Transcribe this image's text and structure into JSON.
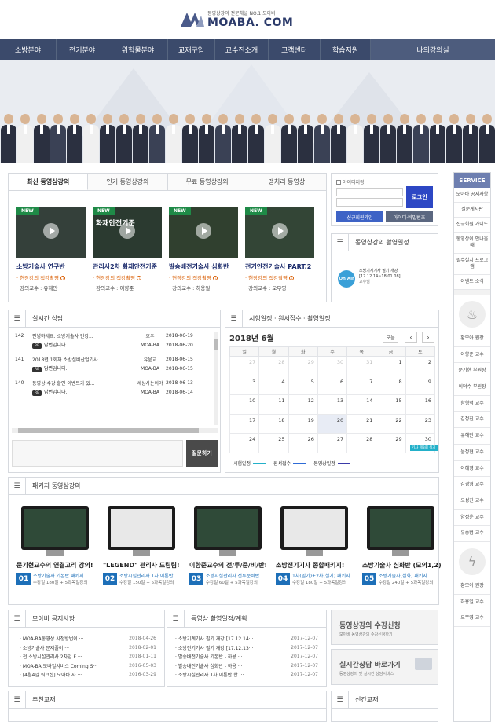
{
  "header": {
    "tagline": "동영상강의 전문채널 NO.1 모아바",
    "logo": "MOABA. COM"
  },
  "nav": [
    "소방분야",
    "전기분야",
    "위험물분야",
    "교재구입",
    "교수진소개",
    "고객센터",
    "학습지원",
    "나의강의실"
  ],
  "latest": {
    "tabs": [
      "최신 동영상강의",
      "인기 동영상강의",
      "무료 동영상강의",
      "맹처리 동영상"
    ],
    "new_badge": "NEW",
    "videos": [
      {
        "title": "소방기술사 연구반",
        "tag": "· 현장강의 직강촬영",
        "prof": "· 강의교수 : 유해만",
        "overlay": ""
      },
      {
        "title": "관리사2차 화재안전기준",
        "tag": "· 현장강의 직강촬영",
        "prof": "· 강의교수 : 이향준",
        "overlay": "화재안전기준"
      },
      {
        "title": "발송배전기술사 심화반",
        "tag": "· 현장강의 직강촬영",
        "prof": "· 강의교수 : 하용일",
        "overlay": ""
      },
      {
        "title": "전기안전기술사 PART.2",
        "tag": "· 현장강의 직강촬영",
        "prof": "· 강의교수 : 오무영",
        "overlay": ""
      }
    ]
  },
  "login": {
    "save_id": "아이디저장",
    "button": "로그인",
    "join": "신규회원가입",
    "find": "아이디·비밀번호"
  },
  "schedule_box": {
    "title": "동영상강의 촬영일정",
    "badge": "On Air",
    "text1": "소방기계기사 필기 개강",
    "text2": "[17.12.14~18.01.08]",
    "text3": "교수님"
  },
  "consult": {
    "title": "실시간 상담",
    "rows": [
      {
        "no": "142",
        "q": "안녕하세요. 소방기술사 인강...",
        "who": "호우",
        "date": "2018-06-19",
        "reply": "답변입니다.",
        "rwho": "MOA-BA",
        "rdate": "2018-06-20"
      },
      {
        "no": "141",
        "q": "2018년 1회차 소방설비산업기사...",
        "who": "유윤교",
        "date": "2018-06-15",
        "reply": "답변입니다.",
        "rwho": "MOA-BA",
        "rdate": "2018-06-15"
      },
      {
        "no": "140",
        "q": "동영상 수강 할인 이벤트가 있...",
        "who": "세상사는이야",
        "date": "2018-06-13",
        "reply": "답변입니다.",
        "rwho": "MOA-BA",
        "rdate": "2018-06-14"
      }
    ],
    "ask_button": "질문하기"
  },
  "calendar": {
    "title": "시험일정 · 원서접수 · 촬영일정",
    "month": "2018년 6월",
    "today": "오늘",
    "days": [
      "일",
      "월",
      "화",
      "수",
      "목",
      "금",
      "토"
    ],
    "weeks": [
      [
        [
          "27",
          1
        ],
        [
          "28",
          1
        ],
        [
          "29",
          1
        ],
        [
          "30",
          1
        ],
        [
          "31",
          1
        ],
        [
          "1",
          0
        ],
        [
          "2",
          0
        ]
      ],
      [
        [
          "3",
          0
        ],
        [
          "4",
          0
        ],
        [
          "5",
          0
        ],
        [
          "6",
          0
        ],
        [
          "7",
          0
        ],
        [
          "8",
          0
        ],
        [
          "9",
          0
        ]
      ],
      [
        [
          "10",
          0
        ],
        [
          "11",
          0
        ],
        [
          "12",
          0
        ],
        [
          "13",
          0
        ],
        [
          "14",
          0
        ],
        [
          "15",
          0
        ],
        [
          "16",
          0
        ]
      ],
      [
        [
          "17",
          0
        ],
        [
          "18",
          0
        ],
        [
          "19",
          0
        ],
        [
          "20",
          0
        ],
        [
          "21",
          0
        ],
        [
          "22",
          0
        ],
        [
          "23",
          0
        ]
      ],
      [
        [
          "24",
          0
        ],
        [
          "25",
          0
        ],
        [
          "26",
          0
        ],
        [
          "27",
          0
        ],
        [
          "28",
          0
        ],
        [
          "29",
          0
        ],
        [
          "30",
          0
        ]
      ]
    ],
    "event": "기사 제3회 실기",
    "legend": [
      {
        "label": "시험일정",
        "color": "#23b0c9"
      },
      {
        "label": "원서접수",
        "color": "#2e6bd6"
      },
      {
        "label": "동영상일정",
        "color": "#3a3aa8"
      }
    ]
  },
  "packages": {
    "title": "패키지 동영상강의",
    "items": [
      {
        "num": "01",
        "title": "문기현교수의 연결고리 강의!",
        "name": "소방기술사 기본반 패키지",
        "desc": "수강일 180일 + 5과목일강의"
      },
      {
        "num": "02",
        "title": "\"LEGEND\" 관리사 드림팀!",
        "name": "소방시설관리사 1차 이론반",
        "desc": "수강일 150일 + 5과목일강의"
      },
      {
        "num": "03",
        "title": "이향준교수의 전/투/준/비/반!",
        "name": "소방시설관리사 전투준비반",
        "desc": "수강일 60일 + 5과목일강의"
      },
      {
        "num": "04",
        "title": "소방전기기사 종합패키지!",
        "name": "1차(필기)+2차(실기) 패키지",
        "desc": "수강일 180일 + 5과목일강의"
      },
      {
        "num": "05",
        "title": "소방기술사 심화반 (모의1,2)",
        "name": "소방기술사(심화) 패키지",
        "desc": "수강일 240일 + 5과목일강의"
      }
    ]
  },
  "notice": {
    "title": "모아바 공지사항",
    "rows": [
      {
        "t": "· MOA-BA동영상 시청방법이 ···",
        "d": "2018-04-26"
      },
      {
        "t": "· 소방기술사 문제풀이 ···",
        "d": "2018-02-01"
      },
      {
        "t": "· 전 소방시설관리사 2차임 F ···",
        "d": "2018-01-11"
      },
      {
        "t": "· MOA-BA 모바일서비스 Coming S···",
        "d": "2016-05-03"
      },
      {
        "t": "· [4월4일 워크샵] 모아바 사 ···",
        "d": "2016-03-29"
      }
    ]
  },
  "shoot": {
    "title": "동영상 촬영일정/계획",
    "rows": [
      {
        "t": "· 소방기계기사 필기 개강 [17.12.14···",
        "d": "2017-12-07"
      },
      {
        "t": "· 소방전기기사 필기 개강 [17.12.13···",
        "d": "2017-12-07"
      },
      {
        "t": "· 발송배전기술사 기본반 - 하용 ···",
        "d": "2017-12-07"
      },
      {
        "t": "· 발송배전기술사 심화반 - 하용 ···",
        "d": "2017-12-07"
      },
      {
        "t": "· 소방시설관리사 1차 이론반 합 ···",
        "d": "2017-12-07"
      }
    ]
  },
  "banners": {
    "b1_title": "동영상강의 수강신청",
    "b1_sub": "모아바 동영상강의 수강신청하기",
    "b2_title": "실시간상담 바로가기",
    "b2_sub": "동영상강의 및 실시간 상담서비스"
  },
  "bottom": {
    "textbook": "추천교재",
    "newbook": "신간교재"
  },
  "sidebar": {
    "header": "SERVICE",
    "items": [
      "모아바 공지사항",
      "질문게시판",
      "신규회원 가이드",
      "동영상이 안나올때",
      "필수설치 프로그램",
      "이벤트 소식"
    ],
    "profs1": [
      "황모아 원장",
      "이향준 교수",
      "문기현 부원장",
      "이덕수 부원장",
      "함형덕 교수",
      "김정진 교수",
      "유해만 교수",
      "윤정현 교수",
      "이혜영 교수",
      "김경영 교수",
      "오성진 교수",
      "양성운 교수",
      "유승범 교수"
    ],
    "profs2": [
      "황모아 원장",
      "하용일 교수",
      "오무영 교수"
    ]
  },
  "colors": {
    "nav": "#3b4a6b",
    "accent": "#2d47c4",
    "number": "#1d6fb8"
  }
}
